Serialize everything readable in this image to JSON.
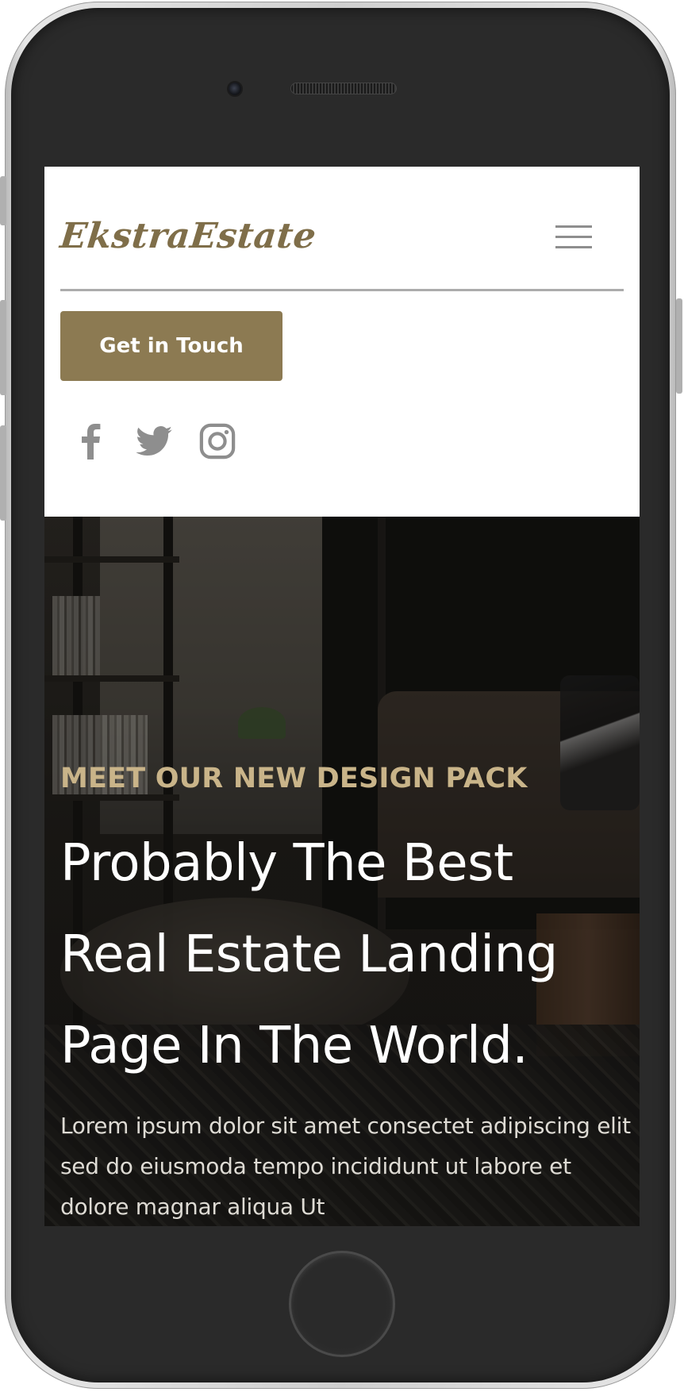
{
  "brand": {
    "logo_text": "EkstraEstate",
    "accent_color": "#8c7a52",
    "eyebrow_color": "#c9b489"
  },
  "header": {
    "menu_icon": "hamburger-menu-icon",
    "cta_label": "Get in Touch",
    "social": [
      {
        "name": "facebook-icon"
      },
      {
        "name": "twitter-icon"
      },
      {
        "name": "instagram-icon"
      }
    ]
  },
  "hero": {
    "eyebrow": "MEET OUR NEW DESIGN PACK",
    "headline_lines": [
      "Probably The Best",
      "Real Estate Landing",
      "Page In The World."
    ],
    "body": "Lorem ipsum dolor sit amet consectet adipiscing elit sed do eiusmoda tempo incididunt ut labore et dolore magnar aliqua Ut"
  }
}
